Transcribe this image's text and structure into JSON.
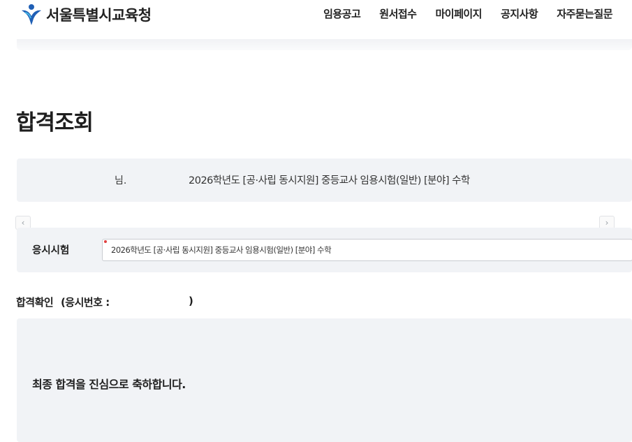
{
  "header": {
    "logo_text": "서울특별시교육청",
    "logo_icon": "seoul-education-office-logo-icon",
    "brand_color": "#1f5fb5",
    "nav_items": [
      {
        "label": "임용공고"
      },
      {
        "label": "원서접수"
      },
      {
        "label": "마이페이지"
      },
      {
        "label": "공지사항"
      },
      {
        "label": "자주묻는질문"
      }
    ]
  },
  "page": {
    "title": "합격조회"
  },
  "info": {
    "name_suffix": "님.",
    "exam_name": "2026학년도 [공·사립 동시지원] 중등교사 임용시험(일반) [분야] 수학"
  },
  "scroll": {
    "left_icon": "chevron-left-icon",
    "right_icon": "chevron-right-icon"
  },
  "exam_select": {
    "label": "응시시험",
    "value": "2026학년도 [공·사립 동시지원] 중등교사 임용시험(일반) [분야] 수학"
  },
  "result": {
    "title": "합격확인",
    "exam_number_label": "(응시번호 :",
    "exam_number_close": ")",
    "message": "최종 합격을 진심으로 축하합니다."
  }
}
